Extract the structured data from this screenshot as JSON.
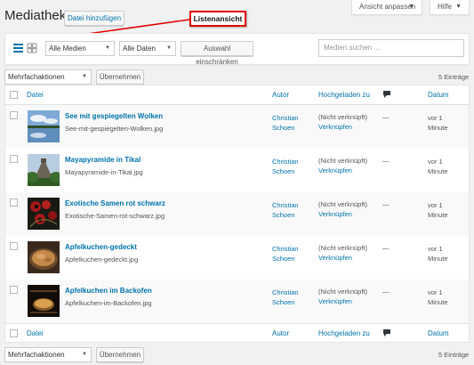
{
  "header": {
    "title": "Mediathek",
    "add_button": "Datei hinzufügen",
    "screen_options": "Ansicht anpassen",
    "help": "Hilfe"
  },
  "annotation": {
    "label": "Listenansicht",
    "color": "#e00000"
  },
  "filters": {
    "view_list_icon": "list-view-icon",
    "view_grid_icon": "grid-view-icon",
    "media_type": "Alle Medien",
    "dates": "Alle Daten",
    "filter_button": "Auswahl einschränken",
    "search_placeholder": "Medien suchen ..."
  },
  "bulk_top": {
    "select": "Mehrfachaktionen",
    "apply": "Übernehmen",
    "count": "5 Einträge"
  },
  "bulk_bottom": {
    "select": "Mehrfachaktionen",
    "apply": "Übernehmen",
    "count": "5 Einträge"
  },
  "columns": {
    "file": "Datei",
    "author": "Autor",
    "uploaded_to": "Hochgeladen zu",
    "comments_icon": "comment-bubble-icon",
    "date": "Datum"
  },
  "rows": [
    {
      "title": "See mit gespiegelten Wolken",
      "filename": "See-mit-gespiegelten-Wolken.jpg",
      "author_first": "Christian",
      "author_last": "Schoen",
      "attached": "(Nicht verknüpft)",
      "attach_link": "Verknüpfen",
      "comments": "—",
      "date_1": "vor 1",
      "date_2": "Minute"
    },
    {
      "title": "Mayapyramide in Tikal",
      "filename": "Mayapyramide-in-Tikal.jpg",
      "author_first": "Christian",
      "author_last": "Schoen",
      "attached": "(Nicht verknüpft)",
      "attach_link": "Verknüpfen",
      "comments": "—",
      "date_1": "vor 1",
      "date_2": "Minute"
    },
    {
      "title": "Exotische Samen rot schwarz",
      "filename": "Exotische-Samen-rot-schwarz.jpg",
      "author_first": "Christian",
      "author_last": "Schoen",
      "attached": "(Nicht verknüpft)",
      "attach_link": "Verknüpfen",
      "comments": "—",
      "date_1": "vor 1",
      "date_2": "Minute"
    },
    {
      "title": "Apfelkuchen-gedeckt",
      "filename": "Apfelkuchen-gedeckt.jpg",
      "author_first": "Christian",
      "author_last": "Schoen",
      "attached": "(Nicht verknüpft)",
      "attach_link": "Verknüpfen",
      "comments": "—",
      "date_1": "vor 1",
      "date_2": "Minute"
    },
    {
      "title": "Apfelkuchen im Backofen",
      "filename": "Apfelkuchen-im-Backofen.jpg",
      "author_first": "Christian",
      "author_last": "Schoen",
      "attached": "(Nicht verknüpft)",
      "attach_link": "Verknüpfen",
      "comments": "—",
      "date_1": "vor 1",
      "date_2": "Minute"
    }
  ]
}
